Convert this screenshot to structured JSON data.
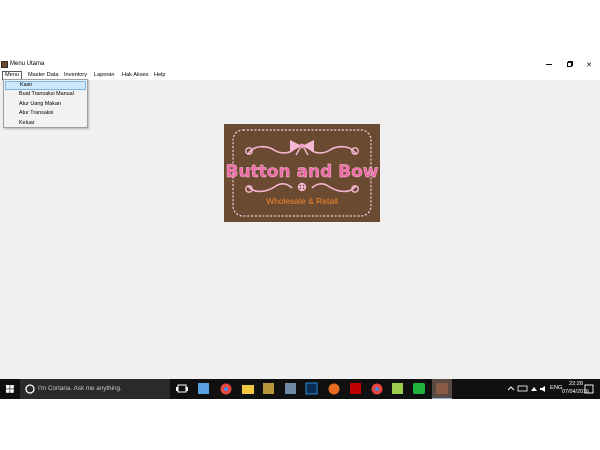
{
  "window": {
    "title": "Menu Utama"
  },
  "menubar": {
    "items": [
      {
        "label": "Menu"
      },
      {
        "label": "Master Data"
      },
      {
        "label": "Inventory"
      },
      {
        "label": "Laporan"
      },
      {
        "label": "Hak Akses"
      },
      {
        "label": "Help"
      }
    ]
  },
  "dropdown": {
    "items": [
      {
        "label": "Kasir"
      },
      {
        "label": "Buat Transaksi Manual"
      },
      {
        "label": "Atur Uang Makan"
      },
      {
        "label": "Atur Transaksi"
      },
      {
        "label": "Keluar"
      }
    ]
  },
  "logo": {
    "title": "Button and Bow",
    "subtitle": "Wholesale & Retail"
  },
  "taskbar": {
    "search_placeholder": "I'm Cortana. Ask me anything.",
    "language": "ENG",
    "time": "22:28",
    "date": "07/04/2016"
  },
  "colors": {
    "logo_bg": "#6b4a32",
    "logo_pink": "#f06aa8",
    "logo_orange": "#f08a2e",
    "taskbar_bg": "#101010"
  }
}
